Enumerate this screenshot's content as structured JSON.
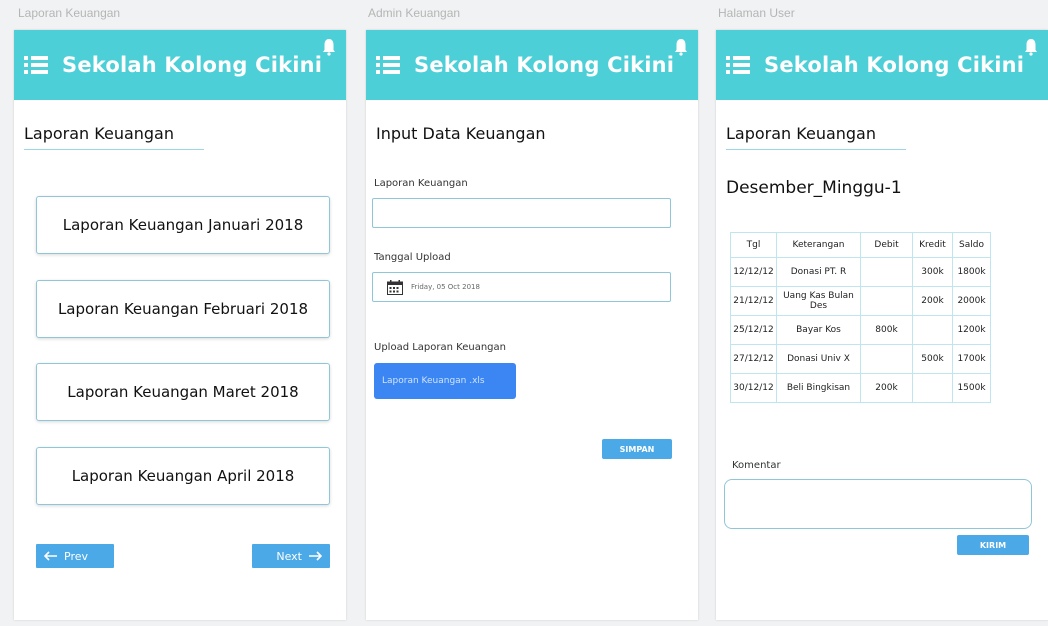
{
  "captions": {
    "screen1": "Laporan Keuangan",
    "screen2": "Admin Keuangan",
    "screen3": "Halaman User"
  },
  "app": {
    "title": "Sekolah Kolong Cikini",
    "menu_icon": "list-icon",
    "bell_icon": "bell-icon",
    "accent_color": "#4ccfd7"
  },
  "report_list": {
    "heading": "Laporan Keuangan",
    "items": [
      "Laporan Keuangan Januari 2018",
      "Laporan Keuangan Februari 2018",
      "Laporan Keuangan Maret 2018",
      "Laporan Keuangan April 2018"
    ],
    "prev_label": "Prev",
    "next_label": "Next"
  },
  "admin_form": {
    "heading": "Input Data Keuangan",
    "report_label": "Laporan Keuangan",
    "report_value": "",
    "date_label": "Tanggal Upload",
    "date_value": "Friday, 05 Oct 2018",
    "upload_label": "Upload Laporan Keuangan",
    "upload_button": "Laporan Keuangan .xls",
    "save_button": "SIMPAN"
  },
  "user_page": {
    "heading": "Laporan Keuangan",
    "week_title": "Desember_Minggu-1",
    "table": {
      "headers": [
        "Tgl",
        "Keterangan",
        "Debit",
        "Kredit",
        "Saldo"
      ],
      "rows": [
        [
          "12/12/12",
          "Donasi PT. R",
          "",
          "300k",
          "1800k"
        ],
        [
          "21/12/12",
          "Uang Kas Bulan Des",
          "",
          "200k",
          "2000k"
        ],
        [
          "25/12/12",
          "Bayar Kos",
          "800k",
          "",
          "1200k"
        ],
        [
          "27/12/12",
          "Donasi Univ X",
          "",
          "500k",
          "1700k"
        ],
        [
          "30/12/12",
          "Beli Bingkisan",
          "200k",
          "",
          "1500k"
        ]
      ]
    },
    "comment_label": "Komentar",
    "comment_value": "",
    "send_button": "KIRIM"
  }
}
